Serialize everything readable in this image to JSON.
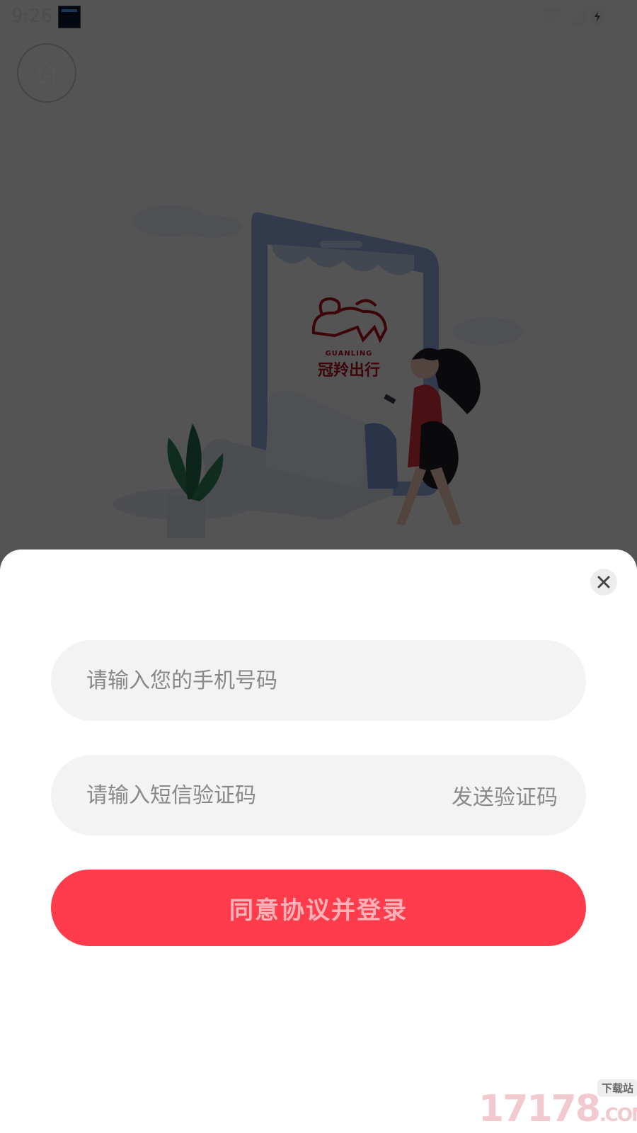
{
  "status_bar": {
    "time": "9:26"
  },
  "illustration": {
    "brand_cn": "冠羚",
    "brand_en": "GUANLING",
    "tagline": "冠羚出行"
  },
  "login": {
    "phone_placeholder": "请输入您的手机号码",
    "sms_placeholder": "请输入短信验证码",
    "send_code": "发送验证码",
    "submit": "同意协议并登录"
  },
  "watermark": {
    "text": "17178",
    "suffix": ".COM",
    "badge": "下载站"
  },
  "colors": {
    "accent": "#fe3c4c",
    "field_bg": "#f3f3f3",
    "brand_red": "#b1111f"
  }
}
